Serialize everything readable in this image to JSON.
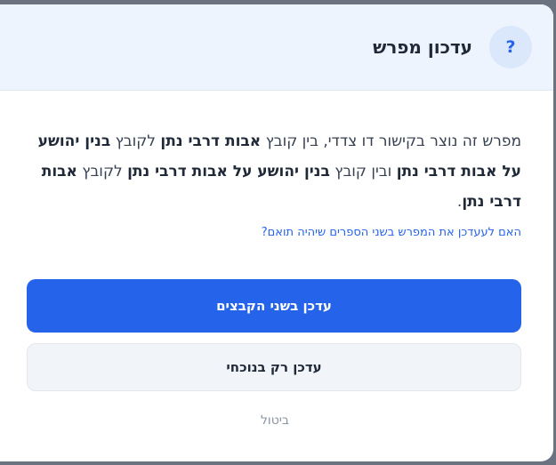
{
  "dialog": {
    "title": "עדכון מפרש",
    "help_icon": "?",
    "message": {
      "t1": "מפרש זה נוצר בקישור דו צדדי, בין קובץ ",
      "b1": "אבות דרבי נתן",
      "t2": " לקובץ ",
      "b2": "בנין יהושע על אבות דרבי נתן",
      "t3": " ובין קובץ ",
      "b3": "בנין יהושע על אבות דרבי נתן",
      "t4": " לקובץ ",
      "b4": "אבות דרבי נתן",
      "t5": "."
    },
    "question": "האם לעעדכן את המפרש בשני הספרים שיהיה תואם?",
    "primary_button": "עדכן בשני הקבצים",
    "secondary_button": "עדכן רק בנוכחי",
    "cancel_link": "ביטול"
  },
  "colors": {
    "accent": "#2563eb",
    "header_bg": "#eef4fd",
    "backdrop": "#6b7280"
  },
  "icons": [
    "help-icon"
  ]
}
